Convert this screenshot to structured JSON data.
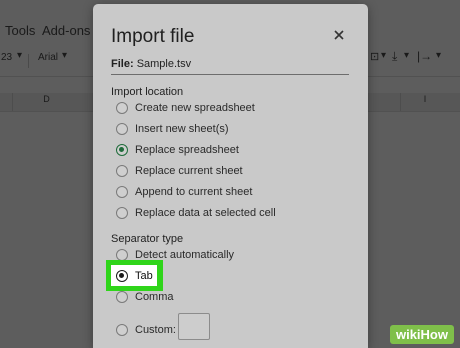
{
  "background": {
    "menu": {
      "tools": "Tools",
      "addons": "Add-ons"
    },
    "toolbar": {
      "zoom": "23",
      "font": "Arial"
    },
    "columns": [
      "D",
      "I"
    ]
  },
  "dialog": {
    "title": "Import file",
    "file_label": "File:",
    "file_name": "Sample.tsv",
    "import_location_label": "Import location",
    "import_location_options": [
      {
        "label": "Create new spreadsheet",
        "checked": false
      },
      {
        "label": "Insert new sheet(s)",
        "checked": false
      },
      {
        "label": "Replace spreadsheet",
        "checked": true
      },
      {
        "label": "Replace current sheet",
        "checked": false
      },
      {
        "label": "Append to current sheet",
        "checked": false
      },
      {
        "label": "Replace data at selected cell",
        "checked": false
      }
    ],
    "separator_label": "Separator type",
    "separator_options": [
      {
        "label": "Detect automatically",
        "checked": false
      },
      {
        "label": "Tab",
        "checked": true
      },
      {
        "label": "Comma",
        "checked": false
      },
      {
        "label": "Custom:",
        "checked": false
      }
    ],
    "custom_value": ""
  },
  "watermark": {
    "wiki": "wiki",
    "how": "How"
  },
  "colors": {
    "highlight": "#2fd51a",
    "radio_checked": "#1e6b3a",
    "dialog_bg": "#c9c9c9"
  }
}
